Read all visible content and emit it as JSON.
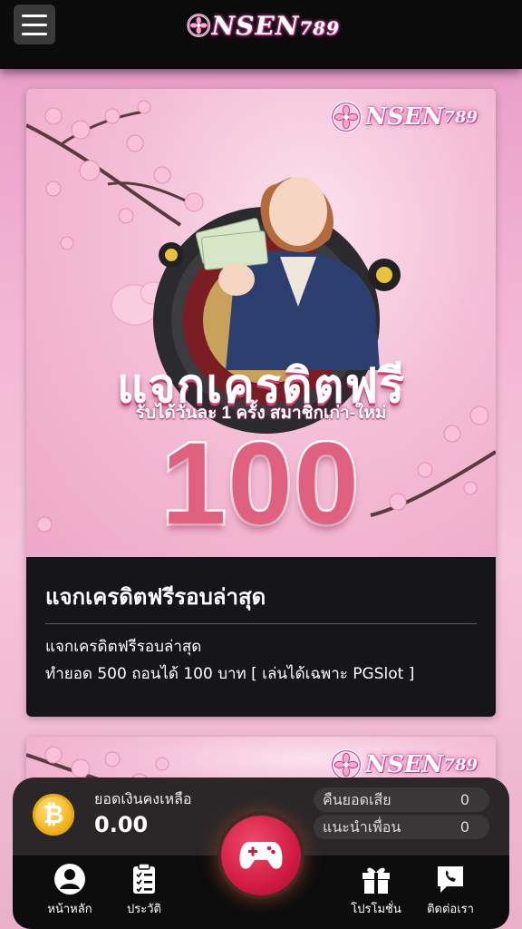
{
  "header": {
    "logo_text": "NSEN",
    "logo_num": "789"
  },
  "promo": {
    "logo_text": "NSEN",
    "logo_num": "789",
    "banner_heading": "แจกเครดิตฟรี",
    "banner_sub": "รับได้วันละ 1 ครั้ง สมาชิกเก่า-ใหม่",
    "banner_amount": "100",
    "title": "แจกเครดิตฟรีรอบล่าสุด",
    "line1": "แจกเครดิตฟรีรอบล่าสุด",
    "line2": "ทำยอด 500 ถอนได้ 100 บาท [ เล่นได้เฉพาะ PGSlot ]"
  },
  "promo2": {
    "logo_text": "NSEN",
    "logo_num": "789"
  },
  "balance": {
    "label": "ยอดเงินคงเหลือ",
    "value": "0.00",
    "cashback_label": "คืนยอดเสีย",
    "cashback_value": "0",
    "referral_label": "แนะนำเพื่อน",
    "referral_value": "0"
  },
  "nav": {
    "home": "หน้าหลัก",
    "history": "ประวัติ",
    "promotion": "โปรโมชั่น",
    "contact": "ติดต่อเรา"
  },
  "colors": {
    "accent": "#d11b43",
    "header_bg": "#0b0b0b",
    "card_body_bg": "#16161a",
    "coin": "#f3b51f"
  }
}
